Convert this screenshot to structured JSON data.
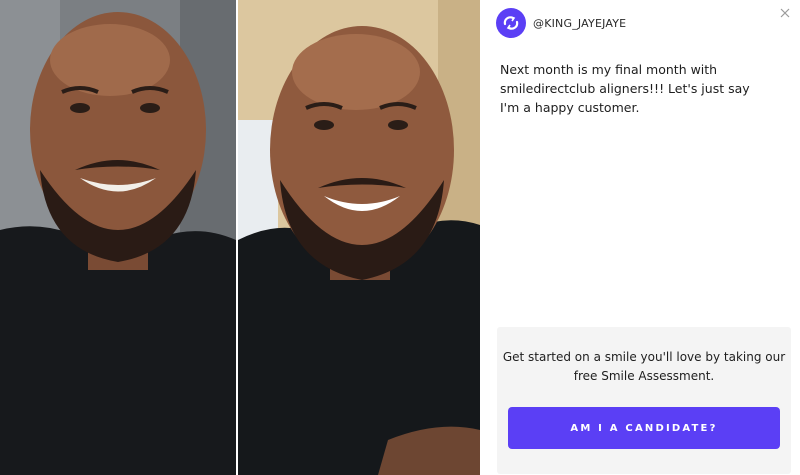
{
  "photos": {
    "before": {
      "description_icon": "before-photo"
    },
    "after": {
      "description_icon": "after-photo"
    }
  },
  "post": {
    "handle": "@KING_JAYEJAYE",
    "caption": "Next month is my final month with smiledirectclub aligners!!! Let's just say I'm a happy customer."
  },
  "cta": {
    "text": "Get started on a smile you'll love by taking our free Smile Assessment.",
    "button_label": "AM I A CANDIDATE?"
  },
  "colors": {
    "brand": "#5b3ff5",
    "cta_background": "#f4f4f4"
  },
  "icons": {
    "brand": "brand-logo-icon",
    "close": "close-icon"
  }
}
